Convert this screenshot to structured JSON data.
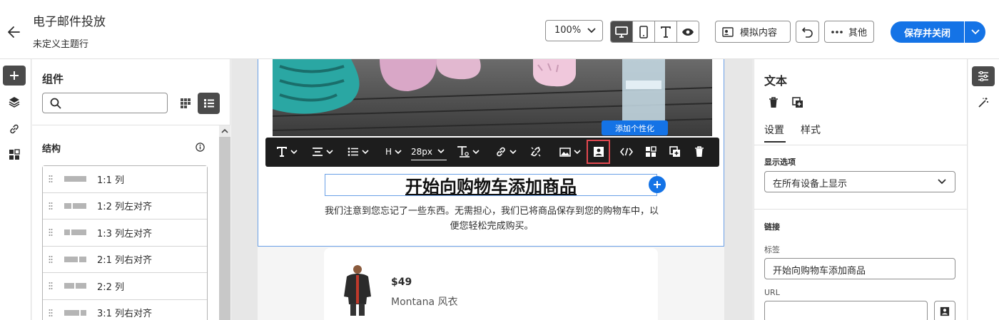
{
  "header": {
    "title": "电子邮件投放",
    "subtitle": "未定义主题行",
    "zoom": "100%",
    "simulate_label": "模拟内容",
    "more_label": "其他",
    "save_label": "保存并关闭"
  },
  "components": {
    "title": "组件",
    "search_placeholder": "",
    "structure_title": "结构",
    "structures": [
      {
        "label": "1:1 列"
      },
      {
        "label": "1:2 列左对齐"
      },
      {
        "label": "1:3 列左对齐"
      },
      {
        "label": "2:1 列右对齐"
      },
      {
        "label": "2:2 列"
      },
      {
        "label": "3:1 列右对齐"
      }
    ]
  },
  "canvas": {
    "tooltip": "添加个性化",
    "toolbar": {
      "heading_label": "H",
      "font_size": "28px"
    },
    "headline": "开始向购物车添加商品",
    "body": "我们注意到您忘记了一些东西。无需担心，我们已将商品保存到您的购物车中，以便您轻松完成购买。",
    "product": {
      "price": "$49",
      "name": "Montana 风衣"
    }
  },
  "properties": {
    "title": "文本",
    "tabs": [
      {
        "label": "设置"
      },
      {
        "label": "样式"
      }
    ],
    "display_section": "显示选项",
    "display_value": "在所有设备上显示",
    "link_section": "链接",
    "label_caption": "标签",
    "label_value": "开始向购物车添加商品",
    "url_caption": "URL",
    "url_value": ""
  }
}
